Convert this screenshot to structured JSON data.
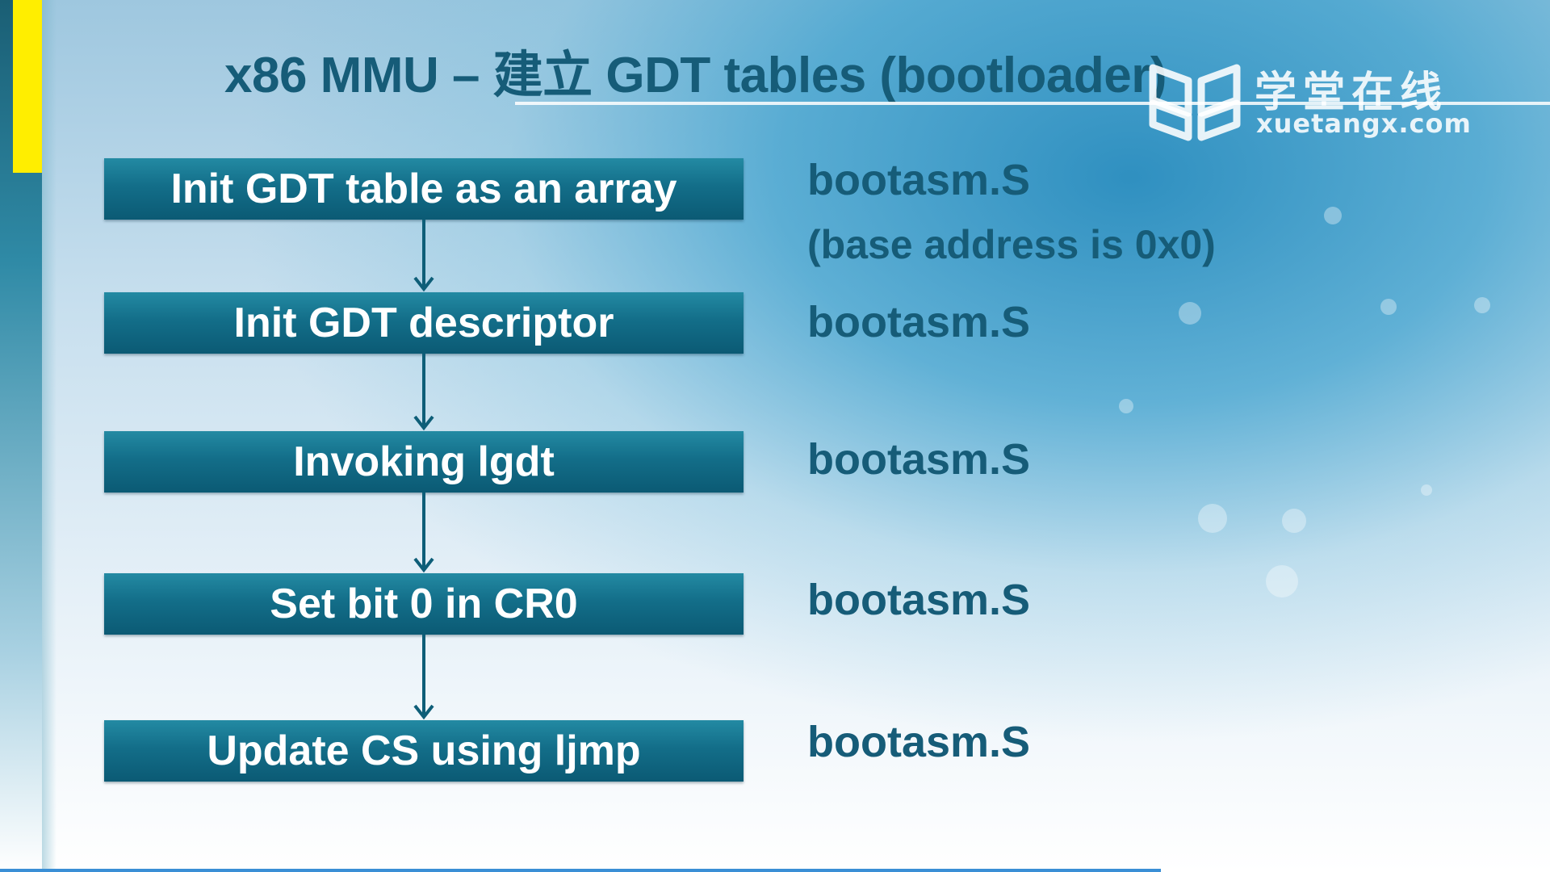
{
  "slide": {
    "title": "x86 MMU – 建立 GDT tables (bootloader)"
  },
  "watermark": {
    "name_cn": "学堂在线",
    "domain": "xuetangx.com",
    "icon": "open-book-icon"
  },
  "steps": [
    {
      "label": "Init GDT table as an array",
      "file": "bootasm.S",
      "note": "(base address is 0x0)"
    },
    {
      "label": "Init GDT descriptor",
      "file": "bootasm.S"
    },
    {
      "label": "Invoking lgdt",
      "file": "bootasm.S"
    },
    {
      "label": "Set bit 0 in CR0",
      "file": "bootasm.S"
    },
    {
      "label": "Update CS using ljmp",
      "file": "bootasm.S"
    }
  ],
  "colors": {
    "box": "#136e89",
    "text": "#165c78",
    "accent": "#ffee00"
  }
}
